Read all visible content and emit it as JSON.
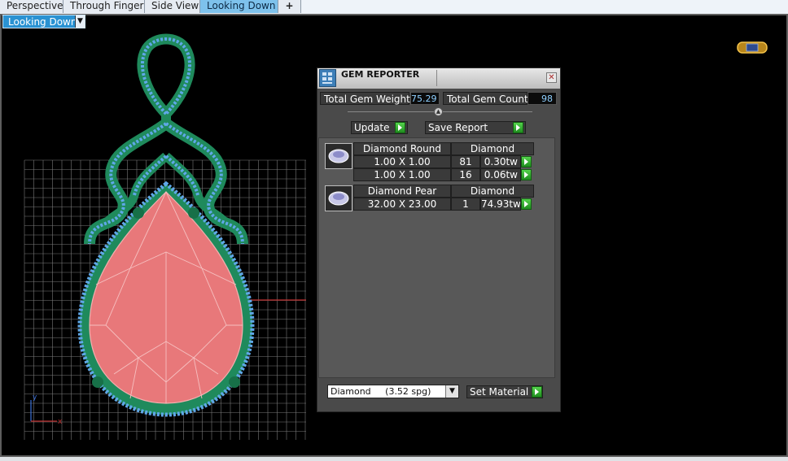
{
  "tabs": [
    {
      "label": "Perspective"
    },
    {
      "label": "Through Finger"
    },
    {
      "label": "Side View"
    },
    {
      "label": "Looking Down",
      "active": true
    }
  ],
  "add_tab_glyph": "+",
  "viewport": {
    "view_label": "Looking Down",
    "axis_x": "x",
    "axis_y": "y"
  },
  "gem_reporter": {
    "title": "GEM REPORTER",
    "total_weight_label": "Total Gem Weight",
    "total_weight": "75.29",
    "total_count_label": "Total Gem Count",
    "total_count": "98",
    "update_label": "Update",
    "save_report_label": "Save Report",
    "groups": [
      {
        "name": "Diamond Round",
        "material": "Diamond",
        "rows": [
          {
            "size": "1.00 X 1.00",
            "count": "81",
            "weight": "0.30tw"
          },
          {
            "size": "1.00 X 1.00",
            "count": "16",
            "weight": "0.06tw"
          }
        ]
      },
      {
        "name": "Diamond Pear",
        "material": "Diamond",
        "rows": [
          {
            "size": "32.00 X 23.00",
            "count": "1",
            "weight": "74.93tw"
          }
        ]
      }
    ],
    "material_select": "Diamond     (3.52 spg)",
    "set_material_label": "Set Material"
  },
  "colors": {
    "tab_active": "#7ec2ec",
    "panel_bg": "#4a4a4a",
    "gem_pink": "#e8787a",
    "metal_green": "#1f8a5c",
    "pave_blue": "#5fa8e8",
    "grid": "#8a8a8a",
    "value_text": "#8fd0ff",
    "go_button": "#2fb32b"
  },
  "icons": {
    "add_tab": "plus-icon",
    "view_dropdown": "chevron-down-icon",
    "view_cube": "view-cube-icon",
    "panel_logo": "gem-reporter-logo-icon",
    "close": "close-icon",
    "go": "green-arrow-icon",
    "gem_thumbnail": "gem-thumbnail-icon"
  }
}
